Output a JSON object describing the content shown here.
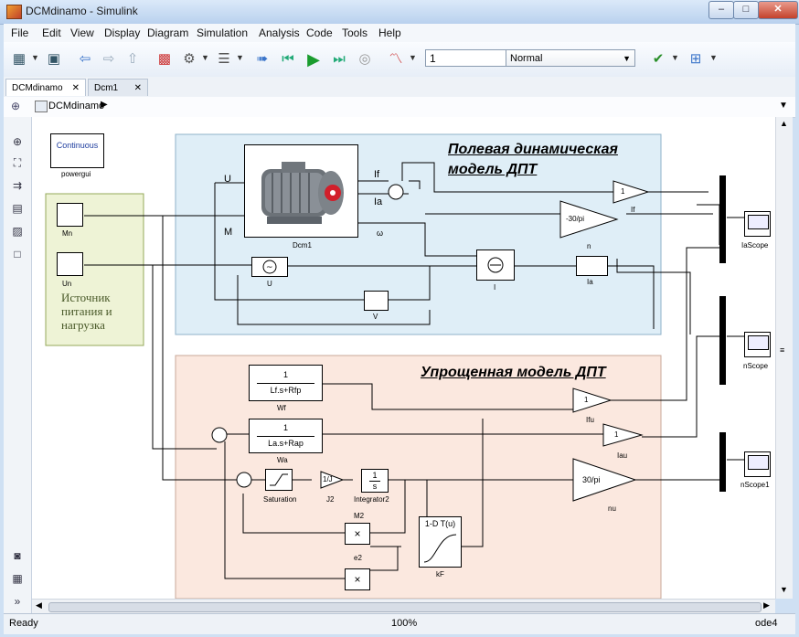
{
  "window": {
    "title": "DCMdinamo - Simulink",
    "min": "–",
    "max": "□",
    "close": "✕"
  },
  "menu": [
    "File",
    "Edit",
    "View",
    "Display",
    "Diagram",
    "Simulation",
    "Analysis",
    "Code",
    "Tools",
    "Help"
  ],
  "toolbar": {
    "stop_time": "1",
    "sim_mode": "Normal"
  },
  "tabs": [
    {
      "label": "DCMdinamo",
      "active": true
    },
    {
      "label": "Dcm1",
      "active": false
    }
  ],
  "breadcrumb": {
    "model": "DCMdinamo"
  },
  "status": {
    "left": "Ready",
    "zoom": "100%",
    "solver": "ode4"
  },
  "model": {
    "field_title_1": "Полевая динамическая",
    "field_title_2": "модель ДПТ",
    "simple_title": "Упрощенная модель ДПТ",
    "source_text": [
      "Источник",
      "питания и",
      "нагрузка"
    ],
    "continuous": "Continuous",
    "powergui": "powergui",
    "mn": "Mn",
    "un": "Un",
    "port_u": "U",
    "port_m": "M",
    "port_if": "If",
    "port_ia": "Ia",
    "port_w": "ω",
    "dcm1": "Dcm1",
    "gain1": "1",
    "label_If": "If",
    "gain_neg": "-30/pi",
    "label_n": "n",
    "label_U": "U",
    "label_I": "I",
    "label_Ia": "Ia",
    "label_V": "V",
    "wf_num": "1",
    "wf_den": "Lf.s+Rfp",
    "wf_name": "Wf",
    "wa_num": "1",
    "wa_den": "La.s+Rap",
    "wa_name": "Wa",
    "sat_name": "Saturation",
    "j_gain": "1/J",
    "j_name": "J2",
    "int_num": "1",
    "int_den": "s",
    "int_name": "Integrator2",
    "ifu_gain": "1",
    "ifu_name": "Ifu",
    "iau_gain": "1",
    "iau_name": "Iau",
    "nu_gain": "30/pi",
    "nu_name": "nu",
    "m2": "M2",
    "e2": "e2",
    "lut_text": "1-D T(u)",
    "lut_name": "kF",
    "scope1": "IaScope",
    "scope2": "nScope",
    "scope3": "nScope1"
  }
}
